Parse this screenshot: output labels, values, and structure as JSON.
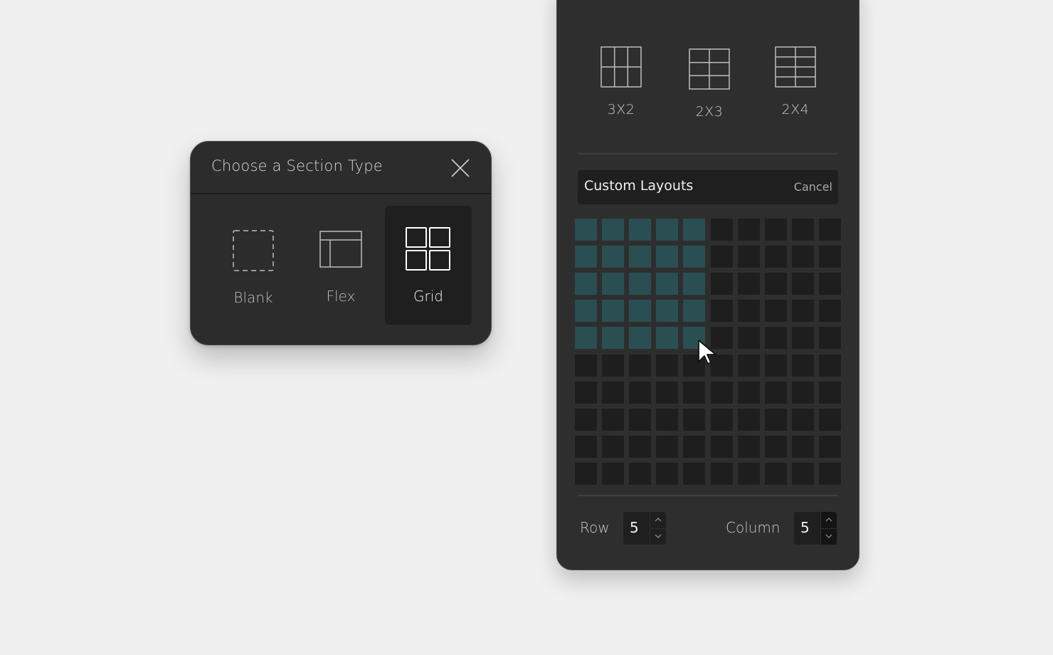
{
  "dialog": {
    "title": "Choose a Section Type",
    "options": [
      {
        "label": "Blank",
        "icon": "dashed-square-icon"
      },
      {
        "label": "Flex",
        "icon": "flex-layout-icon"
      },
      {
        "label": "Grid",
        "icon": "grid-icon",
        "selected": true
      }
    ]
  },
  "panel": {
    "presets": [
      {
        "label": "3X2",
        "icon": "grid-3x2-icon"
      },
      {
        "label": "2X3",
        "icon": "grid-2x3-icon"
      },
      {
        "label": "2X4",
        "icon": "grid-2x4-icon"
      }
    ],
    "custom_title": "Custom Layouts",
    "cancel_label": "Cancel",
    "grid": {
      "total_rows": 10,
      "total_columns": 10,
      "selected_rows": 5,
      "selected_columns": 5
    },
    "row_label": "Row",
    "row_value": "5",
    "column_label": "Column",
    "column_value": "5"
  },
  "colors": {
    "accent": "#2a4f52",
    "panel_bg": "#2e2e2e",
    "cell_bg": "#1e1e1e"
  }
}
